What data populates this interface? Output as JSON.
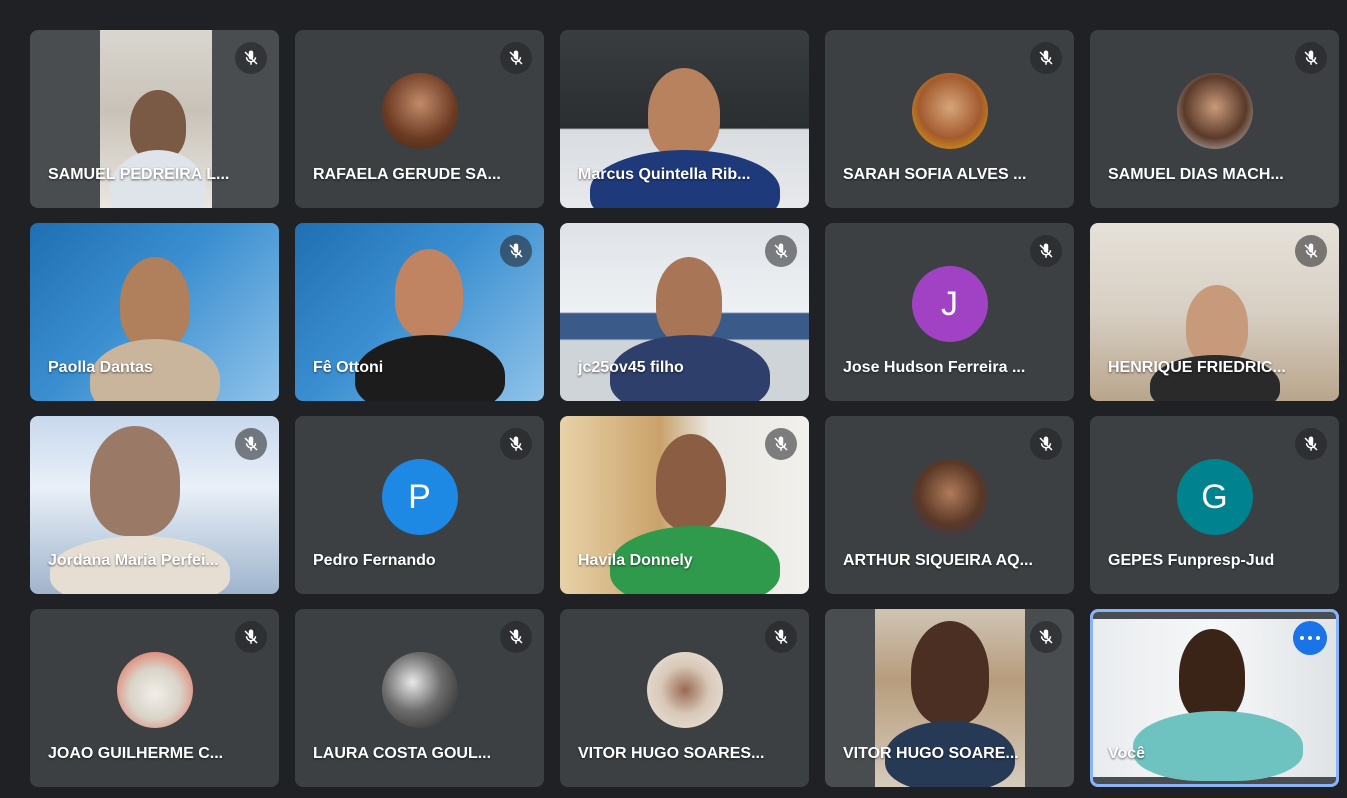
{
  "participants": [
    {
      "name": "SAMUEL PEDREIRA L...",
      "type": "video"
    },
    {
      "name": "RAFAELA GERUDE SA...",
      "type": "photo"
    },
    {
      "name": "Marcus Quintella Rib...",
      "type": "video"
    },
    {
      "name": "SARAH SOFIA ALVES ...",
      "type": "photo"
    },
    {
      "name": "SAMUEL DIAS MACH...",
      "type": "photo"
    },
    {
      "name": "Paolla Dantas",
      "type": "video"
    },
    {
      "name": "Fê Ottoni",
      "type": "video"
    },
    {
      "name": "jc25ov45 filho",
      "type": "video"
    },
    {
      "name": "Jose Hudson Ferreira ...",
      "type": "letter",
      "letter": "J",
      "color": "#a142c4"
    },
    {
      "name": "HENRIQUE FRIEDRIC...",
      "type": "video"
    },
    {
      "name": "Jordana Maria Perfei...",
      "type": "video"
    },
    {
      "name": "Pedro Fernando",
      "type": "letter",
      "letter": "P",
      "color": "#1e88e5"
    },
    {
      "name": "Havila Donnely",
      "type": "video"
    },
    {
      "name": "ARTHUR SIQUEIRA AQ...",
      "type": "photo"
    },
    {
      "name": "GEPES Funpresp-Jud",
      "type": "letter",
      "letter": "G",
      "color": "#00838f"
    },
    {
      "name": "JOAO GUILHERME C...",
      "type": "photo"
    },
    {
      "name": "LAURA COSTA GOUL...",
      "type": "photo"
    },
    {
      "name": "VITOR HUGO SOARES...",
      "type": "photo"
    },
    {
      "name": "VITOR HUGO SOARE...",
      "type": "video"
    },
    {
      "name": "Você",
      "type": "self"
    }
  ],
  "icons": {
    "mic": "mic-off-icon",
    "more": "more-options-icon"
  },
  "colors": {
    "background": "#202124",
    "tile": "#3c4043",
    "self_outline": "#8ab4f8",
    "accent": "#1a73e8"
  }
}
